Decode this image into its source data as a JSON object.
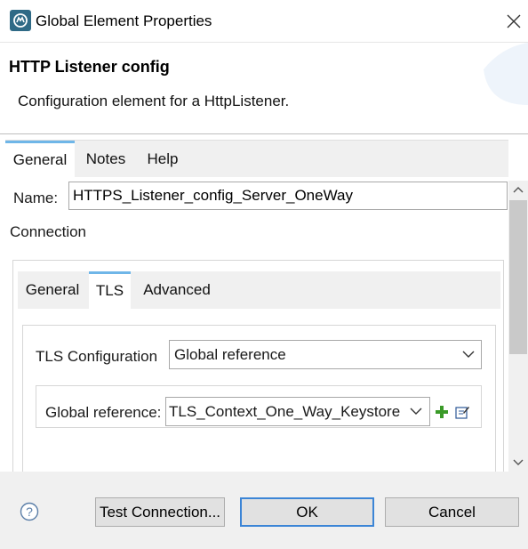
{
  "window": {
    "title": "Global Element Properties",
    "icon": "mule-studio-app-icon",
    "close_icon": "close-icon"
  },
  "header": {
    "title": "HTTP Listener config",
    "description": "Configuration element for a HttpListener."
  },
  "tabs": [
    {
      "label": "General",
      "active": true
    },
    {
      "label": "Notes",
      "active": false
    },
    {
      "label": "Help",
      "active": false
    }
  ],
  "form": {
    "name_label": "Name:",
    "name_value": "HTTPS_Listener_config_Server_OneWay",
    "section_label": "Connection"
  },
  "connection_tabs": [
    {
      "label": "General",
      "active": false
    },
    {
      "label": "TLS",
      "active": true
    },
    {
      "label": "Advanced",
      "active": false
    }
  ],
  "tls": {
    "config_label": "TLS Configuration",
    "config_value": "Global reference",
    "reference_label": "Global reference:",
    "reference_value": "TLS_Context_One_Way_Keystore",
    "add_icon": "plus-icon",
    "edit_icon": "edit-icon"
  },
  "footer": {
    "help_icon": "question-icon",
    "test_connection_label": "Test Connection...",
    "ok_label": "OK",
    "cancel_label": "Cancel"
  },
  "colors": {
    "tab_accent": "#6fb6e8",
    "primary_button_border": "#3c85d6",
    "add_icon": "#3a9a28",
    "footer_bg": "#f0f0f0"
  }
}
